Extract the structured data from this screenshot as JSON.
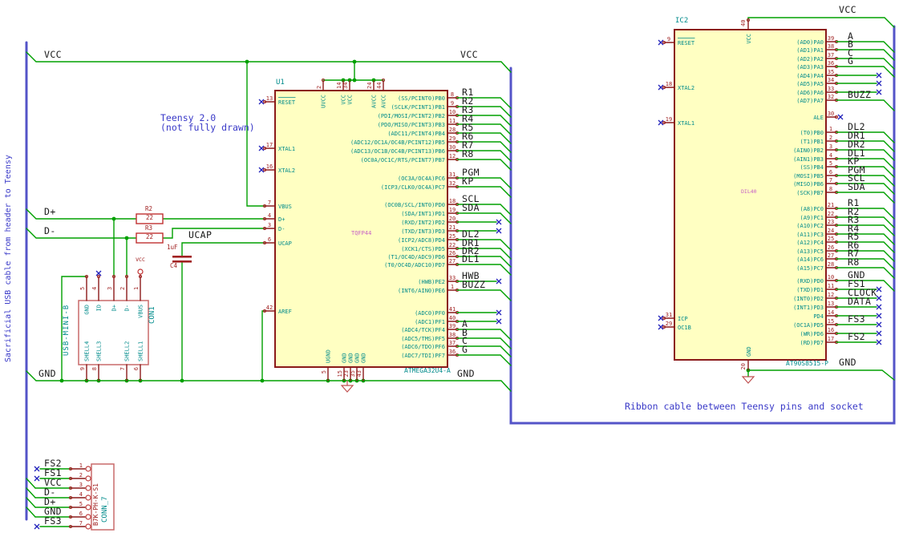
{
  "colors": {
    "wire": "#00A000",
    "bus": "#5454C8",
    "pin_outline": "#8B1A1A",
    "ic_fill": "#FFFFC2",
    "pin_name": "#008B8B",
    "pin_number": "#A02020",
    "value_red": "#AA0000",
    "package_pink": "#C65EC6",
    "no_connect": "#2222BB",
    "note_blue": "#3A3AC8",
    "net_label": "#1a1a1a"
  },
  "notes": {
    "left_vertical": "Sacrificial USB cable from header to Teensy",
    "teensy_line1": "Teensy 2.0",
    "teensy_line2": "(not fully drawn)",
    "ribbon": "Ribbon cable between Teensy pins and socket"
  },
  "labels": {
    "vcc": "VCC",
    "gnd": "GND",
    "dplus": "D+",
    "dminus": "D-",
    "ucap": "UCAP"
  },
  "power": {
    "vcc_flag": "VCC"
  },
  "r2": {
    "ref": "R2",
    "value": "22"
  },
  "r3": {
    "ref": "R3",
    "value": "22"
  },
  "c4": {
    "ref": "C4",
    "value": "1uF"
  },
  "u1": {
    "ref": "U1",
    "value": "ATMEGA32U4-A",
    "package": "TQFP44",
    "left_pins": [
      {
        "num": "13",
        "name": "RESET",
        "conn": "nc",
        "overline": true
      },
      {
        "num": "17",
        "name": "XTAL1",
        "conn": "nc"
      },
      {
        "num": "16",
        "name": "XTAL2",
        "conn": "nc"
      },
      {
        "num": "7",
        "name": "VBUS",
        "conn": "wire"
      },
      {
        "num": "4",
        "name": "D+",
        "conn": "wire"
      },
      {
        "num": "3",
        "name": "D-",
        "conn": "wire"
      },
      {
        "num": "6",
        "name": "UCAP",
        "conn": "wire"
      },
      {
        "num": "42",
        "name": "AREF",
        "conn": "wire"
      }
    ],
    "top_pins": [
      {
        "num": "2",
        "name": "UVCC"
      },
      {
        "num": "14",
        "name": "VCC"
      },
      {
        "num": "34",
        "name": "VCC"
      },
      {
        "num": "24",
        "name": "AVCC"
      },
      {
        "num": "44",
        "name": "AVCC"
      }
    ],
    "bottom_pins": [
      {
        "num": "5",
        "name": "UGND"
      },
      {
        "num": "15",
        "name": "GND"
      },
      {
        "num": "23",
        "name": "GND"
      },
      {
        "num": "35",
        "name": "GND"
      },
      {
        "num": "43",
        "name": "GND"
      }
    ],
    "right_pins": [
      {
        "num": "8",
        "name": "(SS/PCINT0)PB0",
        "net": "R1",
        "conn": "bus"
      },
      {
        "num": "9",
        "name": "(SCLK/PCINT1)PB1",
        "net": "R2",
        "conn": "bus"
      },
      {
        "num": "10",
        "name": "(PDI/MOSI/PCINT2)PB2",
        "net": "R3",
        "conn": "bus"
      },
      {
        "num": "11",
        "name": "(PDO/MISO/PCINT3)PB3",
        "net": "R4",
        "conn": "bus"
      },
      {
        "num": "28",
        "name": "(ADC11/PCINT4)PB4",
        "net": "R5",
        "conn": "bus"
      },
      {
        "num": "29",
        "name": "(ADC12/OC1A/OC4B/PCINT12)PB5",
        "net": "R6",
        "conn": "bus"
      },
      {
        "num": "30",
        "name": "(ADC13/OC1B/OC4B/PCINT13)PB6",
        "net": "R7",
        "conn": "bus"
      },
      {
        "num": "12",
        "name": "(OC0A/OC1C/RTS/PCINT7)PB7",
        "net": "R8",
        "conn": "bus"
      },
      {
        "num": "31",
        "name": "(OC3A/OC4A)PC6",
        "net": "PGM",
        "conn": "bus"
      },
      {
        "num": "32",
        "name": "(ICP3/CLK0/OC4A)PC7",
        "net": "KP",
        "conn": "bus"
      },
      {
        "num": "18",
        "name": "(OC0B/SCL/INT0)PD0",
        "net": "SCL",
        "conn": "bus"
      },
      {
        "num": "19",
        "name": "(SDA/INT1)PD1",
        "net": "SDA",
        "conn": "bus"
      },
      {
        "num": "20",
        "name": "(RXD/INT2)PD2",
        "conn": "nc"
      },
      {
        "num": "21",
        "name": "(TXD/INT3)PD3",
        "conn": "nc"
      },
      {
        "num": "25",
        "name": "(ICP2/ADC8)PD4",
        "net": "DL2",
        "conn": "bus"
      },
      {
        "num": "22",
        "name": "(XCK1/CTS)PD5",
        "net": "DR1",
        "conn": "bus"
      },
      {
        "num": "26",
        "name": "(T1/OC4D/ADC9)PD6",
        "net": "DR2",
        "conn": "bus"
      },
      {
        "num": "27",
        "name": "(T0/OC4D/ADC10)PD7",
        "net": "DL1",
        "conn": "bus"
      },
      {
        "num": "33",
        "name": "(HWB)PE2",
        "net": "HWB",
        "conn": "nc"
      },
      {
        "num": "1",
        "name": "(INT6/AIN0)PE6",
        "net": "BUZZ",
        "conn": "bus"
      },
      {
        "num": "41",
        "name": "(ADC0)PF0",
        "conn": "nc"
      },
      {
        "num": "40",
        "name": "(ADC1)PF1",
        "conn": "nc"
      },
      {
        "num": "39",
        "name": "(ADC4/TCK)PF4",
        "net": "A",
        "conn": "bus"
      },
      {
        "num": "38",
        "name": "(ADC5/TMS)PF5",
        "net": "B",
        "conn": "bus"
      },
      {
        "num": "37",
        "name": "(ADC6/TDO)PF6",
        "net": "C",
        "conn": "bus"
      },
      {
        "num": "36",
        "name": "(ADC7/TDI)PF7",
        "net": "G",
        "conn": "bus"
      }
    ]
  },
  "ic2": {
    "ref": "IC2",
    "value": "AT90S8515-P",
    "package": "DIL40",
    "top_pin": {
      "num": "40",
      "name": "VCC"
    },
    "bottom_pin": {
      "num": "20",
      "name": "GND"
    },
    "left_pins": [
      {
        "num": "9",
        "name": "RESET",
        "conn": "nc",
        "overline": true
      },
      {
        "num": "18",
        "name": "XTAL2",
        "conn": "nc"
      },
      {
        "num": "19",
        "name": "XTAL1",
        "conn": "nc"
      },
      {
        "num": "31",
        "name": "ICP",
        "conn": "nc"
      },
      {
        "num": "29",
        "name": "OC1B",
        "conn": "nc"
      }
    ],
    "right_pins": [
      {
        "num": "39",
        "name": "(AD0)PA0",
        "net": "A",
        "conn": "bus"
      },
      {
        "num": "38",
        "name": "(AD1)PA1",
        "net": "B",
        "conn": "bus"
      },
      {
        "num": "37",
        "name": "(AD2)PA2",
        "net": "C",
        "conn": "bus"
      },
      {
        "num": "36",
        "name": "(AD3)PA3",
        "net": "G",
        "conn": "bus"
      },
      {
        "num": "35",
        "name": "(AD4)PA4",
        "conn": "nc"
      },
      {
        "num": "34",
        "name": "(AD5)PA5",
        "conn": "nc"
      },
      {
        "num": "33",
        "name": "(AD6)PA6",
        "conn": "nc"
      },
      {
        "num": "32",
        "name": "(AD7)PA7",
        "net": "BUZZ",
        "conn": "bus"
      },
      {
        "num": "30",
        "name": "ALE",
        "conn": "ncpin"
      },
      {
        "num": "1",
        "name": "(T0)PB0",
        "net": "DL2",
        "conn": "bus"
      },
      {
        "num": "2",
        "name": "(T1)PB1",
        "net": "DR1",
        "conn": "bus"
      },
      {
        "num": "3",
        "name": "(AIN0)PB2",
        "net": "DR2",
        "conn": "bus"
      },
      {
        "num": "4",
        "name": "(AIN1)PB3",
        "net": "DL1",
        "conn": "bus"
      },
      {
        "num": "5",
        "name": "(SS)PB4",
        "net": "KP",
        "conn": "bus"
      },
      {
        "num": "6",
        "name": "(MOSI)PB5",
        "net": "PGM",
        "conn": "bus"
      },
      {
        "num": "7",
        "name": "(MISO)PB6",
        "net": "SCL",
        "conn": "bus"
      },
      {
        "num": "8",
        "name": "(SCK)PB7",
        "net": "SDA",
        "conn": "bus"
      },
      {
        "num": "21",
        "name": "(A8)PC0",
        "net": "R1",
        "conn": "bus"
      },
      {
        "num": "22",
        "name": "(A9)PC1",
        "net": "R2",
        "conn": "bus"
      },
      {
        "num": "23",
        "name": "(A10)PC2",
        "net": "R3",
        "conn": "bus"
      },
      {
        "num": "24",
        "name": "(A11)PC3",
        "net": "R4",
        "conn": "bus"
      },
      {
        "num": "25",
        "name": "(A12)PC4",
        "net": "R5",
        "conn": "bus"
      },
      {
        "num": "26",
        "name": "(A13)PC5",
        "net": "R6",
        "conn": "bus"
      },
      {
        "num": "27",
        "name": "(A14)PC6",
        "net": "R7",
        "conn": "bus"
      },
      {
        "num": "28",
        "name": "(A15)PC7",
        "net": "R8",
        "conn": "bus"
      },
      {
        "num": "10",
        "name": "(RXD)PD0",
        "net": "GND",
        "conn": "bus"
      },
      {
        "num": "11",
        "name": "(TXD)PD1",
        "net": "FS1",
        "conn": "nc"
      },
      {
        "num": "12",
        "name": "(INT0)PD2",
        "net": "CLOCK",
        "conn": "nc"
      },
      {
        "num": "13",
        "name": "(INT1)PD3",
        "net": "DATA",
        "conn": "nc"
      },
      {
        "num": "14",
        "name": "PD4",
        "conn": "nc"
      },
      {
        "num": "15",
        "name": "(OC1A)PD5",
        "net": "FS3",
        "conn": "nc"
      },
      {
        "num": "16",
        "name": "(WR)PD6",
        "conn": "nc"
      },
      {
        "num": "17",
        "name": "(RD)PD7",
        "net": "FS2",
        "conn": "nc"
      }
    ]
  },
  "con1": {
    "ref": "CON1",
    "value": "USB-MINI-B",
    "top_pins": [
      {
        "num": "5",
        "name": "GND"
      },
      {
        "num": "4",
        "name": "ID",
        "nc": true
      },
      {
        "num": "3",
        "name": "D+"
      },
      {
        "num": "2",
        "name": "D-"
      },
      {
        "num": "1",
        "name": "VBUS"
      }
    ],
    "bottom_pins": [
      {
        "num": "9",
        "name": "SHELL4"
      },
      {
        "num": "8",
        "name": "SHELL3"
      },
      {
        "num": "7",
        "name": "SHELL2"
      },
      {
        "num": "6",
        "name": "SHELL1"
      }
    ]
  },
  "conn7": {
    "ref": "CONN_7",
    "value": "B7K-PH-K-S1",
    "rows": [
      {
        "num": "1",
        "net": "FS2",
        "nc": true
      },
      {
        "num": "2",
        "net": "FS1",
        "nc": true
      },
      {
        "num": "3",
        "net": "VCC"
      },
      {
        "num": "4",
        "net": "D-"
      },
      {
        "num": "5",
        "net": "D+"
      },
      {
        "num": "6",
        "net": "GND"
      },
      {
        "num": "7",
        "net": "FS3",
        "nc": true
      }
    ]
  }
}
